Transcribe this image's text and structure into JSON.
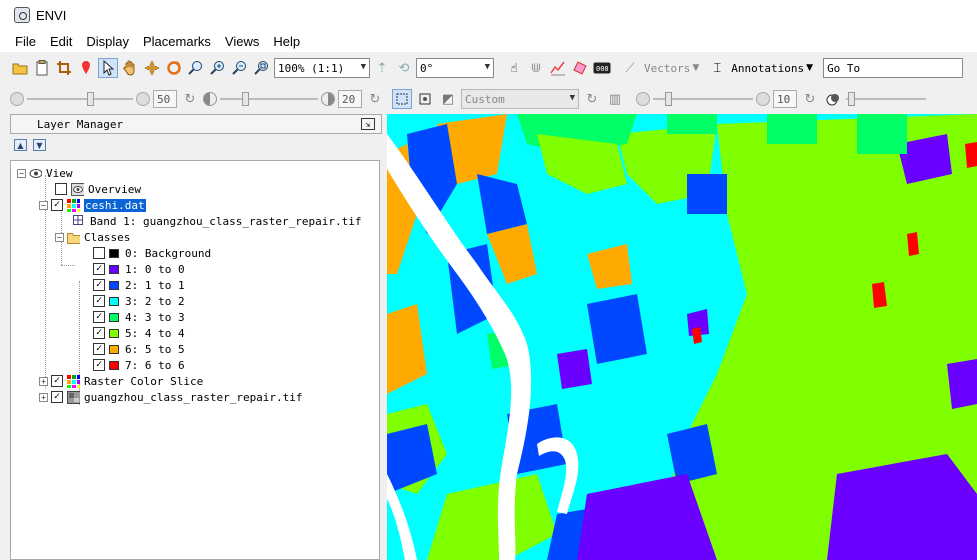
{
  "window": {
    "title": "ENVI"
  },
  "menu": [
    "File",
    "Edit",
    "Display",
    "Placemarks",
    "Views",
    "Help"
  ],
  "toolbar1": {
    "zoom_value": "100% (1:1)",
    "rotation_value": "0°",
    "vectors_label": "Vectors",
    "annotations_label": "Annotations",
    "goto_value": "Go To"
  },
  "toolbar2": {
    "brightness_value": "50",
    "contrast_value": "20",
    "stretch_value": "Custom",
    "sharpen_value": "10"
  },
  "layer_manager": {
    "title": "Layer Manager",
    "tree": [
      {
        "label": "View"
      },
      {
        "label": "Overview"
      },
      {
        "label": "ceshi.dat"
      },
      {
        "label": "Band 1: guangzhou_class_raster_repair.tif"
      },
      {
        "label": "Classes"
      },
      {
        "label": "0: Background",
        "color": "#000000"
      },
      {
        "label": "1: 0 to 0",
        "color": "#6a00ff"
      },
      {
        "label": "2: 1 to 1",
        "color": "#0048ff"
      },
      {
        "label": "3: 2 to 2",
        "color": "#00ffff"
      },
      {
        "label": "4: 3 to 3",
        "color": "#00ff66"
      },
      {
        "label": "5: 4 to 4",
        "color": "#80ff00"
      },
      {
        "label": "6: 5 to 5",
        "color": "#ffaa00"
      },
      {
        "label": "7: 6 to 6",
        "color": "#ff0000"
      },
      {
        "label": "Raster Color Slice"
      },
      {
        "label": "guangzhou_class_raster_repair.tif"
      }
    ]
  },
  "map_colors": {
    "background": "#000000",
    "class1": "#6a00ff",
    "class2": "#0048ff",
    "class3": "#00ffff",
    "class4": "#00ff66",
    "class5": "#80ff00",
    "class6": "#ffaa00",
    "class7": "#ff0000",
    "river": "#ffffff"
  }
}
